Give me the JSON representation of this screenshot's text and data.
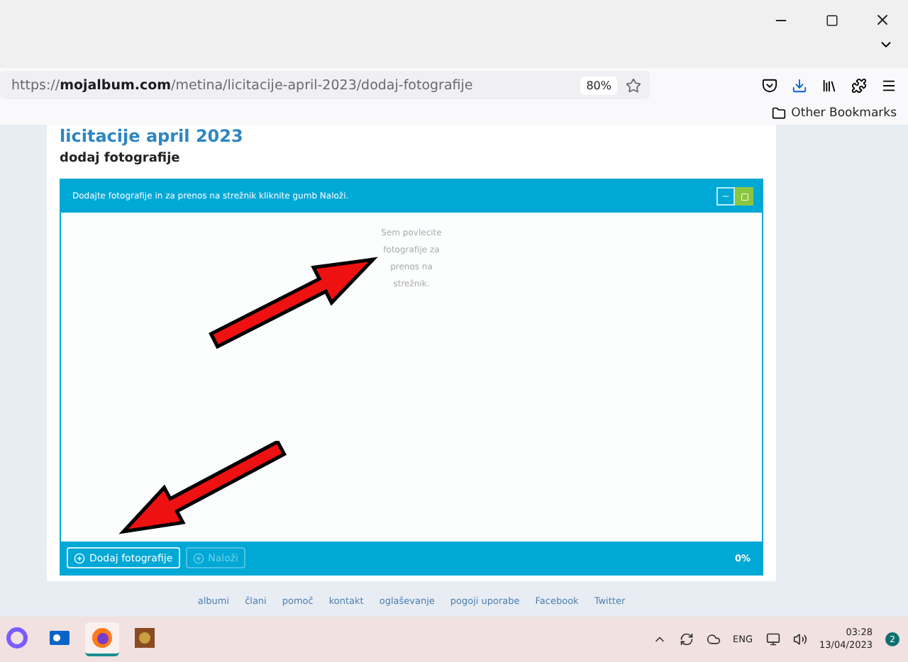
{
  "browser": {
    "url": "https://**mojalbum.com**/metina/licitacije-april-2023/dodaj-fotografije",
    "zoom": "80%",
    "bookmark": "Other Bookmarks"
  },
  "page": {
    "title": "licitacije april 2023",
    "subtitle": "dodaj fotografije",
    "uploader": {
      "instructions": "Dodajte fotografije in za prenos na strežnik kliknite gumb Naloži.",
      "drop_hint": "Sem povlecite fotografije za prenos na strežnik.",
      "buttons": [
        {
          "label": "Dodaj fotografije",
          "disabled": false
        },
        {
          "label": "Naloži",
          "disabled": true
        }
      ],
      "progress": "0%"
    },
    "footer_links": [
      "albumi",
      "člani",
      "pomoč",
      "kontakt",
      "oglaševanje",
      "pogoji uporabe",
      "Facebook",
      "Twitter"
    ]
  },
  "taskbar": {
    "apps": [
      {
        "kind": "copilot",
        "active": false
      },
      {
        "kind": "outlook",
        "active": false
      },
      {
        "kind": "firefox",
        "active": true
      },
      {
        "kind": "picture",
        "active": false
      }
    ],
    "language": "ENG",
    "time": "03:28",
    "date": "13/04/2023",
    "notifications": "2"
  }
}
